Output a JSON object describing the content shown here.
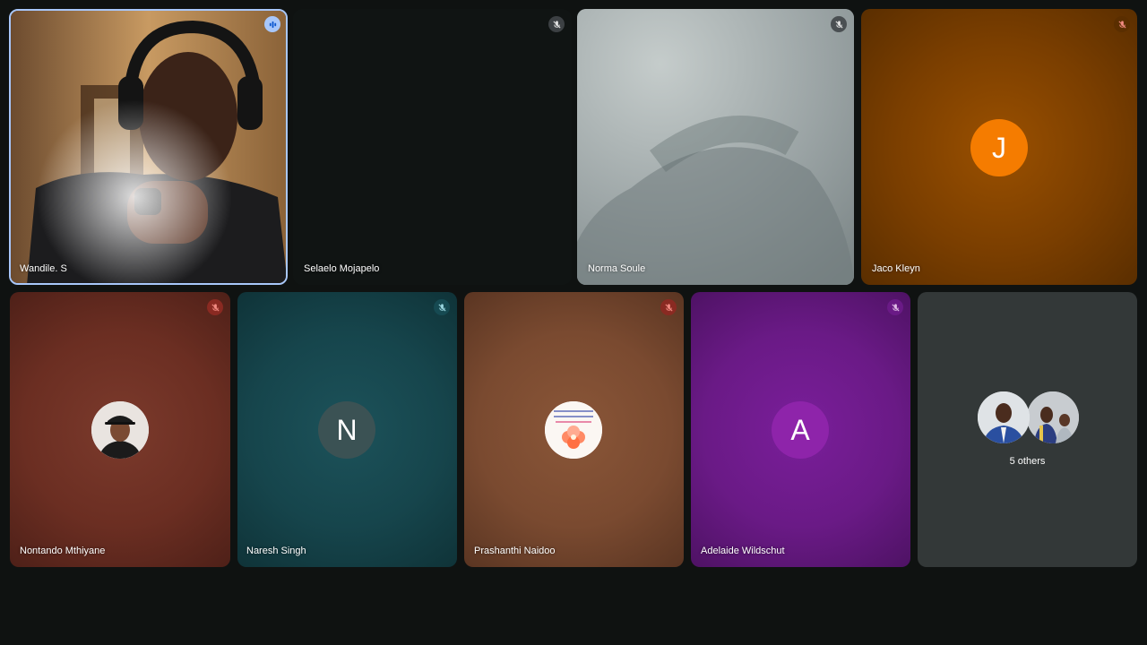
{
  "participants": [
    {
      "name": "Wandile. S",
      "status": "speaking"
    },
    {
      "name": "Selaelo Mojapelo",
      "status": "muted"
    },
    {
      "name": "Norma Soule",
      "status": "muted"
    },
    {
      "name": "Jaco Kleyn",
      "status": "muted",
      "initial": "J"
    },
    {
      "name": "Nontando Mthiyane",
      "status": "muted"
    },
    {
      "name": "Naresh Singh",
      "status": "muted",
      "initial": "N"
    },
    {
      "name": "Prashanthi Naidoo",
      "status": "muted"
    },
    {
      "name": "Adelaide Wildschut",
      "status": "muted",
      "initial": "A"
    }
  ],
  "others": {
    "label": "5 others"
  },
  "colors": {
    "background": "#0f1211",
    "speaking_border": "#a8c7fa",
    "jaco_tile": "#7a3e00",
    "jaco_avatar": "#f57c00",
    "nontando_tile": "#6b2e22",
    "naresh_tile": "#16454c",
    "prashanthi_tile": "#7a4a30",
    "adelaide_tile": "#6a1a86",
    "others_tile": "#333838"
  },
  "icons": {
    "speaking": "audio-level-icon",
    "muted": "mic-off-icon"
  }
}
